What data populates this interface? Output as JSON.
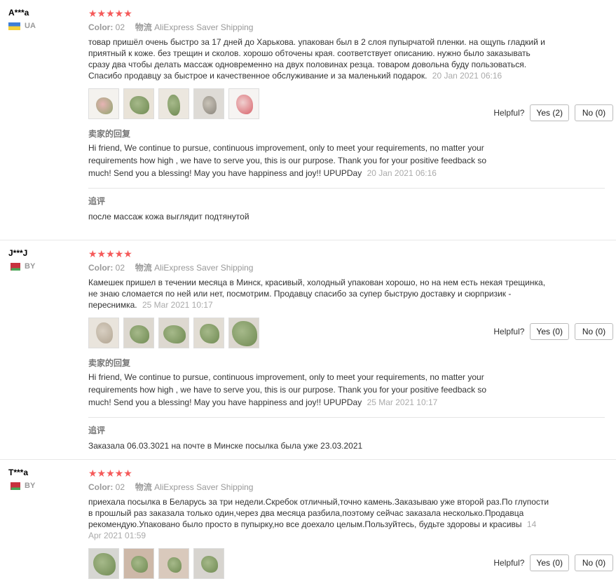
{
  "reviews": [
    {
      "user": "A***a",
      "country": "UA",
      "stars": "★★★★★",
      "color_label": "Color:",
      "color_value": "02",
      "shipping_label": "物流",
      "shipping_value": "AliExpress Saver Shipping",
      "text": "товар пришёл очень быстро за 17 дней до Харькова. упакован был в 2 слоя пупырчатой пленки. на ощупь гладкий и приятный к коже. без трещин и сколов. хорошо обточены края. соответствует описанию. нужно было заказывать сразу два чтобы делать массаж одновременно на двух половинах резца. товаром довольна буду пользоваться. Спасибо продавцу за быстрое и качественное обслуживание и за маленький подарок.",
      "date": "20 Jan 2021 06:16",
      "helpful_label": "Helpful?",
      "yes": "Yes (2)",
      "no": "No (0)",
      "reply_label": "卖家的回复",
      "reply_text": "Hi friend, We continue to pursue, continuous improvement, only to meet your requirements, no matter your requirements how high , we have to serve you, this is our purpose. Thank you for your positive feedback so much! Send you a blessing! May you have happiness and joy!! UPUPDay",
      "reply_date": "20 Jan 2021 06:16",
      "followup_label": "追评",
      "followup_text": "после массаж кожа выглядит подтянутой"
    },
    {
      "user": "J***J",
      "country": "BY",
      "stars": "★★★★★",
      "color_label": "Color:",
      "color_value": "02",
      "shipping_label": "物流",
      "shipping_value": "AliExpress Saver Shipping",
      "text": "Камешек пришел в течении месяца в Минск, красивый, холодный упакован хорошо, но на нем есть некая трещинка, не знаю сломается по ней или нет, посмотрим. Продавцу спасибо за супер быструю доставку и сюрпризик - переснимка.",
      "date": "25 Mar 2021 10:17",
      "helpful_label": "Helpful?",
      "yes": "Yes (0)",
      "no": "No (0)",
      "reply_label": "卖家的回复",
      "reply_text": "Hi friend, We continue to pursue, continuous improvement, only to meet your requirements, no matter your requirements how high , we have to serve you, this is our purpose. Thank you for your positive feedback so much! Send you a blessing! May you have happiness and joy!! UPUPDay",
      "reply_date": "25 Mar 2021 10:17",
      "followup_label": "追评",
      "followup_text": "Заказала 06.03.3021 на почте в Минске посылка была уже 23.03.2021"
    },
    {
      "user": "T***a",
      "country": "BY",
      "stars": "★★★★★",
      "color_label": "Color:",
      "color_value": "02",
      "shipping_label": "物流",
      "shipping_value": "AliExpress Saver Shipping",
      "text": "приехала посылка в Беларусь за три недели.Скребок отличный,точно камень.Заказываю уже второй раз.По глупости в прошлый раз заказала только один,через два месяца разбила,поэтому сейчас заказала несколько.Продавца рекомендую.Упаковано было просто в пупырку,но все доехало целым.Пользуйтесь, будьте здоровы и красивы",
      "date": "14 Apr 2021 01:59",
      "helpful_label": "Helpful?",
      "yes": "Yes (0)",
      "no": "No (0)"
    }
  ],
  "colors": {
    "star": "#f55a5a",
    "muted": "#999999",
    "border": "#bbbbbb"
  },
  "icons": {
    "thumb": "photo-thumbnail-icon",
    "star": "star-icon"
  }
}
